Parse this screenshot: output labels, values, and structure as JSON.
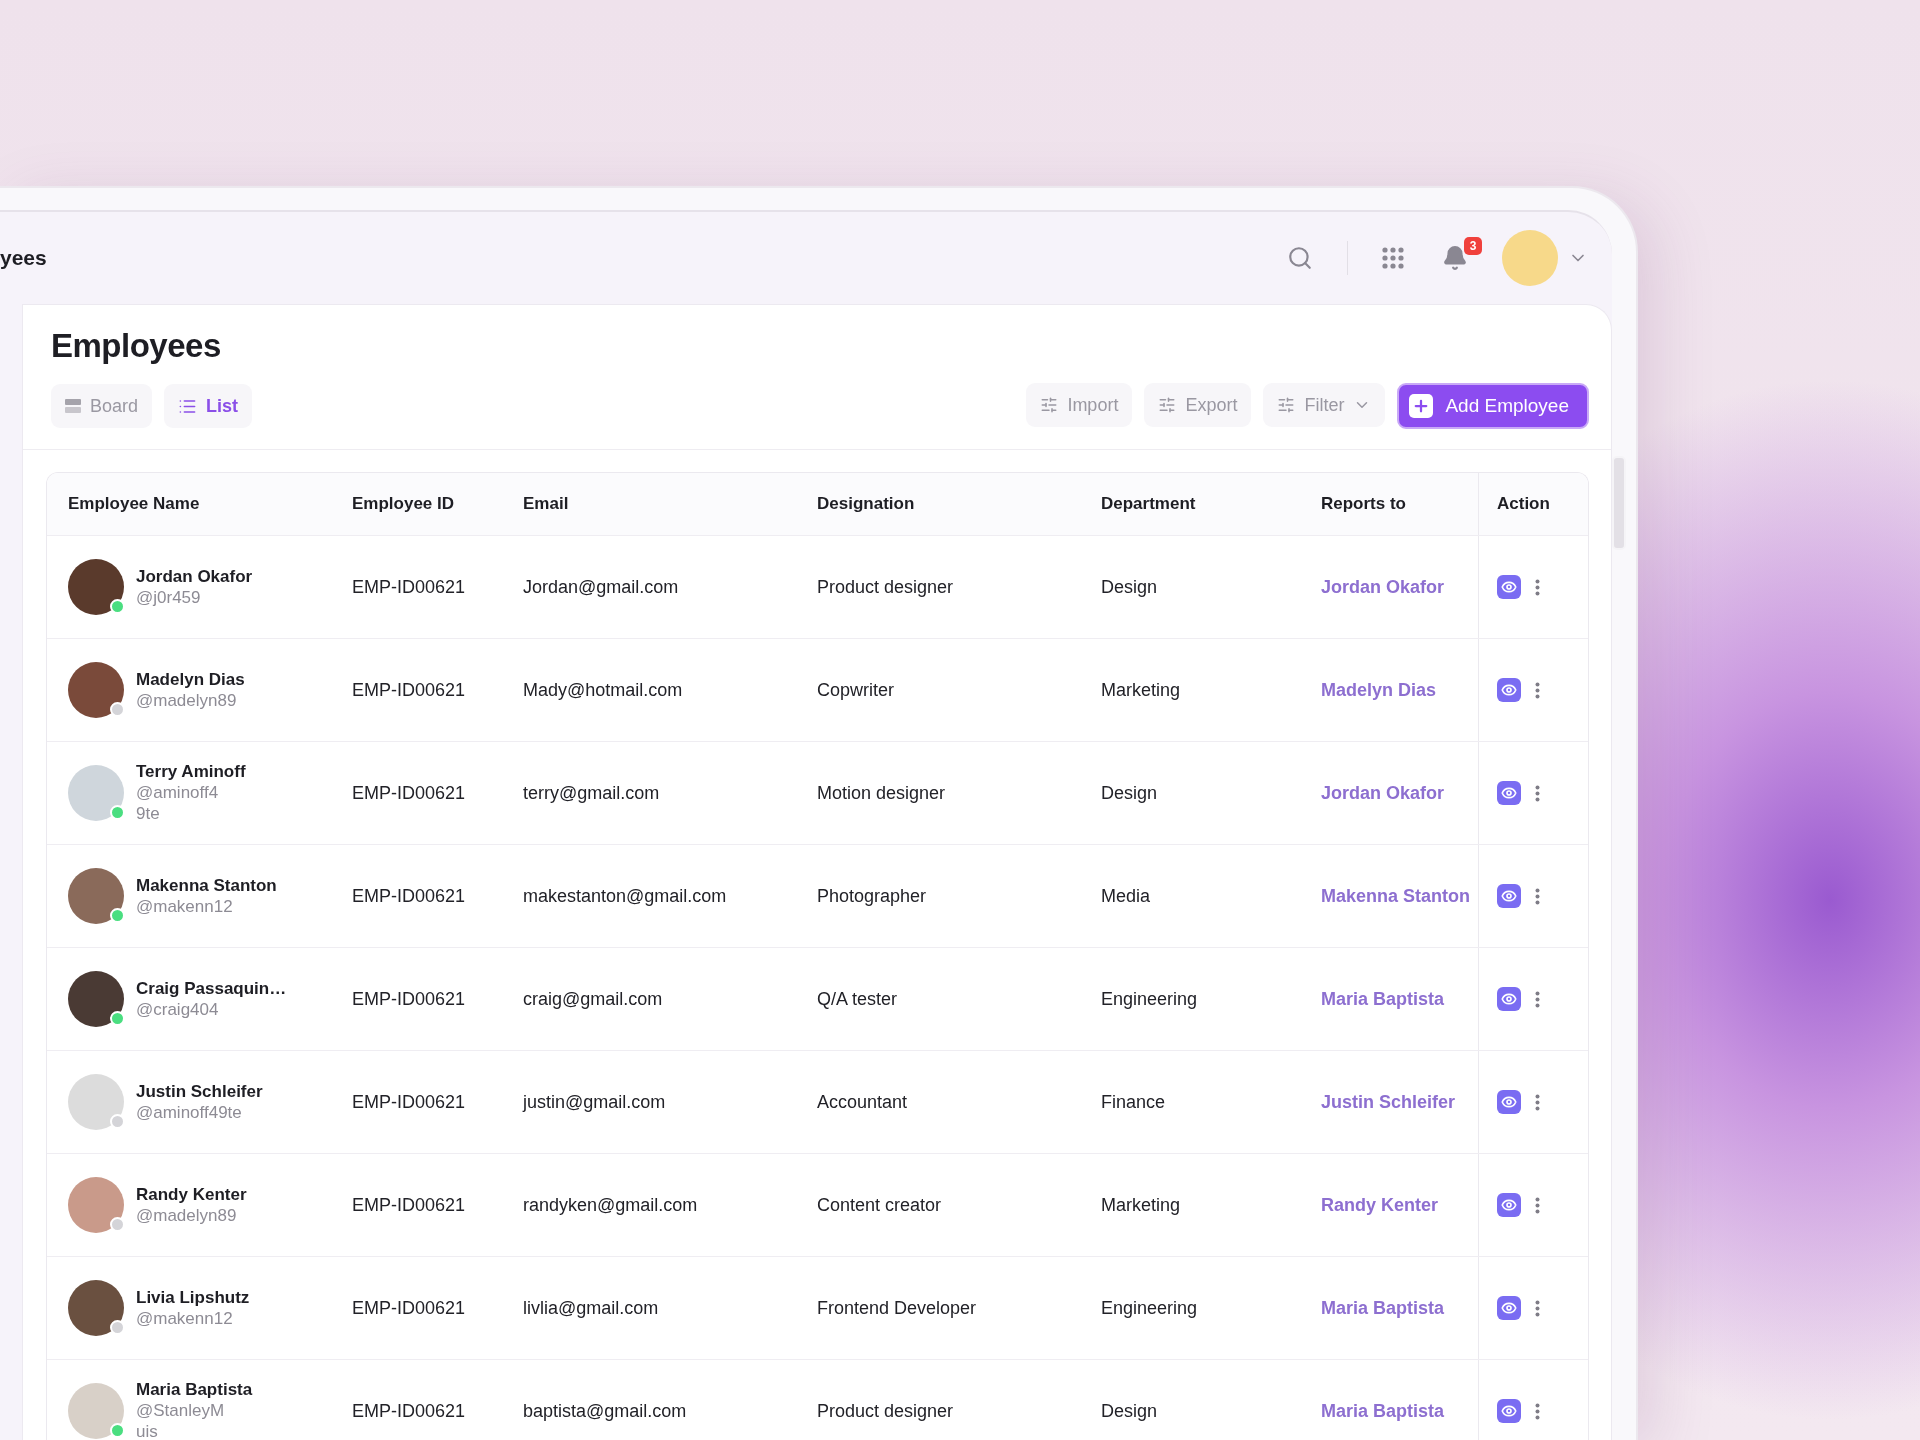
{
  "header": {
    "title": "yees",
    "notification_count": "3"
  },
  "page": {
    "title": "Employees"
  },
  "views": [
    {
      "label": "Board",
      "kind": "board",
      "selected": false
    },
    {
      "label": "List",
      "kind": "list",
      "selected": true
    }
  ],
  "actions": [
    {
      "label": "Import",
      "kind": "import"
    },
    {
      "label": "Export",
      "kind": "export"
    },
    {
      "label": "Filter",
      "kind": "filter"
    },
    {
      "label": "Add Employee",
      "kind": "primary"
    }
  ],
  "table": {
    "columns": [
      "Employee Name",
      "Employee ID",
      "Email",
      "Designation",
      "Department",
      "Reports to",
      "Action"
    ],
    "rows": [
      {
        "name": "Jordan Okafor",
        "handle": [
          "@j0r459"
        ],
        "online": true,
        "employee_id": "EMP-ID00621",
        "email": "Jordan@gmail.com",
        "designation": "Product designer",
        "department": "Design",
        "reports_to": "Jordan Okafor"
      },
      {
        "name": "Madelyn Dias",
        "handle": [
          "@madelyn89"
        ],
        "online": false,
        "employee_id": "EMP-ID00621",
        "email": "Mady@hotmail.com",
        "designation": "Copwriter",
        "department": "Marketing",
        "reports_to": "Madelyn Dias"
      },
      {
        "name": "Terry Aminoff",
        "handle": [
          "@aminoff4",
          "9te"
        ],
        "online": true,
        "employee_id": "EMP-ID00621",
        "email": "terry@gmail.com",
        "designation": "Motion designer",
        "department": "Design",
        "reports_to": "Jordan Okafor"
      },
      {
        "name": "Makenna Stanton",
        "handle": [
          "@makenn12"
        ],
        "online": true,
        "employee_id": "EMP-ID00621",
        "email": "makestanton@gmail.com",
        "designation": "Photographer",
        "department": "Media",
        "reports_to": "Makenna Stanton"
      },
      {
        "name": "Craig Passaquin…",
        "handle": [
          "@craig404"
        ],
        "online": true,
        "employee_id": "EMP-ID00621",
        "email": "craig@gmail.com",
        "designation": "Q/A tester",
        "department": "Engineering",
        "reports_to": "Maria Baptista"
      },
      {
        "name": "Justin Schleifer",
        "handle": [
          "@aminoff49te"
        ],
        "online": false,
        "employee_id": "EMP-ID00621",
        "email": "justin@gmail.com",
        "designation": "Accountant",
        "department": "Finance",
        "reports_to": "Justin Schleifer"
      },
      {
        "name": "Randy Kenter",
        "handle": [
          "@madelyn89"
        ],
        "online": false,
        "employee_id": "EMP-ID00621",
        "email": "randyken@gmail.com",
        "designation": "Content creator",
        "department": "Marketing",
        "reports_to": "Randy Kenter"
      },
      {
        "name": "Livia Lipshutz",
        "handle": [
          "@makenn12"
        ],
        "online": false,
        "employee_id": "EMP-ID00621",
        "email": "livlia@gmail.com",
        "designation": "Frontend Developer",
        "department": "Engineering",
        "reports_to": "Maria Baptista"
      },
      {
        "name": "Maria Baptista",
        "handle": [
          "@StanleyM",
          "uis"
        ],
        "online": true,
        "employee_id": "EMP-ID00621",
        "email": "baptista@gmail.com",
        "designation": "Product designer",
        "department": "Design",
        "reports_to": "Maria Baptista"
      }
    ]
  }
}
